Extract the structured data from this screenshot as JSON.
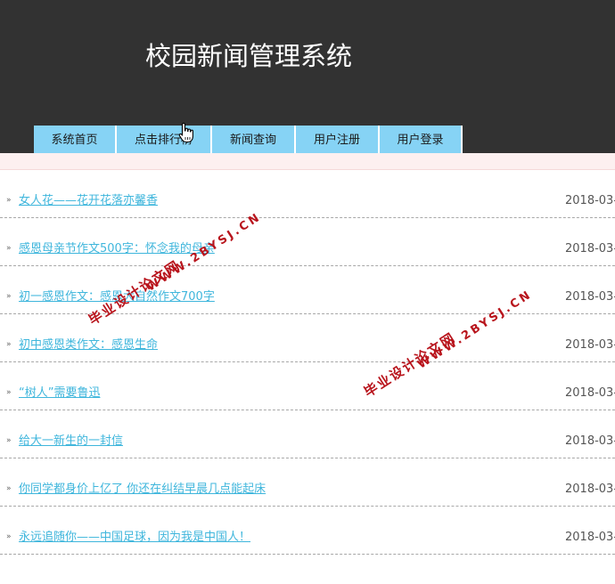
{
  "header": {
    "title": "校园新闻管理系统"
  },
  "nav": {
    "items": [
      {
        "label": "系统首页"
      },
      {
        "label": "点击排行榜"
      },
      {
        "label": "新闻查询"
      },
      {
        "label": "用户注册"
      },
      {
        "label": "用户登录"
      }
    ]
  },
  "news": {
    "bullet_glyph": "»",
    "items": [
      {
        "title": "女人花——花开花落亦馨香",
        "date": "2018-03-"
      },
      {
        "title": "感恩母亲节作文500字：怀念我的母亲",
        "date": "2018-03-"
      },
      {
        "title": "初一感恩作文：感恩大自然作文700字",
        "date": "2018-03-"
      },
      {
        "title": "初中感恩类作文：感恩生命",
        "date": "2018-03-"
      },
      {
        "title": "“树人”需要鲁迅",
        "date": "2018-03-"
      },
      {
        "title": "给大一新生的一封信",
        "date": "2018-03-"
      },
      {
        "title": "你同学都身价上亿了 你还在纠结早晨几点能起床",
        "date": "2018-03-"
      },
      {
        "title": "永远追随你——中国足球，因为我是中国人！",
        "date": "2018-03-"
      }
    ]
  },
  "watermark": {
    "name": "毕业设计论文网",
    "url": "WWW.2BYSJ.CN"
  },
  "colors": {
    "header_bg": "#323232",
    "nav_bg": "#86d3f5",
    "link": "#3fb6dc",
    "watermark": "#b8141c"
  },
  "cursor": {
    "icon": "hand-pointer-icon"
  }
}
